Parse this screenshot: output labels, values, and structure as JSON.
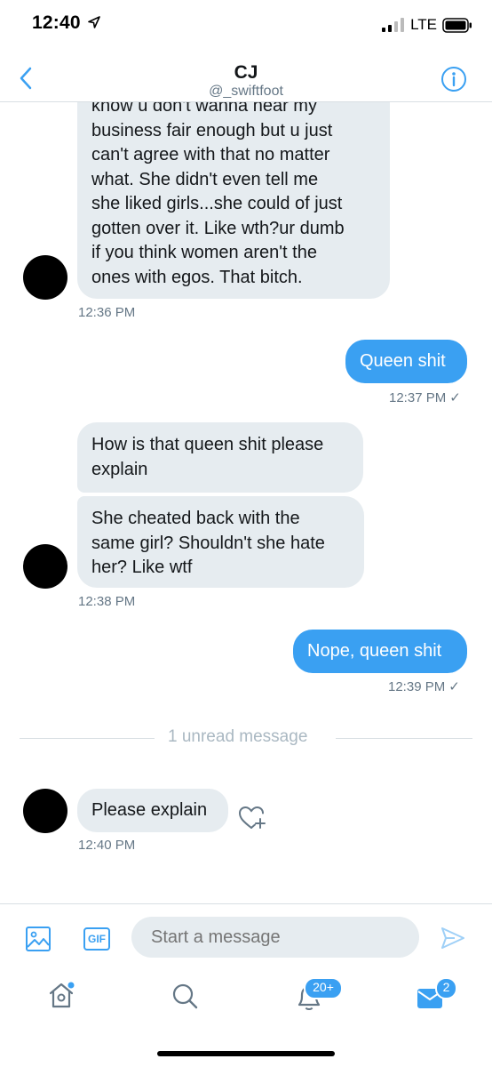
{
  "status_bar": {
    "time": "12:40",
    "network": "LTE"
  },
  "header": {
    "name": "CJ",
    "handle": "@_swiftfoot"
  },
  "messages": {
    "m1": {
      "text": "know u don't wanna hear my\nbusiness fair enough but u just\ncan't agree with that no matter\nwhat. She didn't even tell me\nshe liked girls...she could of just\ngotten over it. Like wth?ur dumb\nif you think women aren't the\nones with egos. That bitch.",
      "time": "12:36 PM"
    },
    "m2": {
      "text": "Queen shit",
      "time": "12:37 PM",
      "check": "✓"
    },
    "m3": {
      "text": "How is that queen shit please\nexplain"
    },
    "m4": {
      "text": "She cheated back with the\nsame girl? Shouldn't she hate\nher? Like wtf",
      "time": "12:38 PM"
    },
    "m5": {
      "text": "Nope, queen shit",
      "time": "12:39 PM",
      "check": "✓"
    },
    "m6": {
      "text": "Please explain",
      "time": "12:40 PM"
    }
  },
  "divider": {
    "label": "1 unread message"
  },
  "composer": {
    "placeholder": "Start a message",
    "gif_label": "GIF"
  },
  "tabs": {
    "notifications_badge": "20+",
    "messages_badge": "2"
  },
  "colors": {
    "accent": "#3aa0f2",
    "bubble_in": "#e6ecf0",
    "meta": "#657786"
  }
}
